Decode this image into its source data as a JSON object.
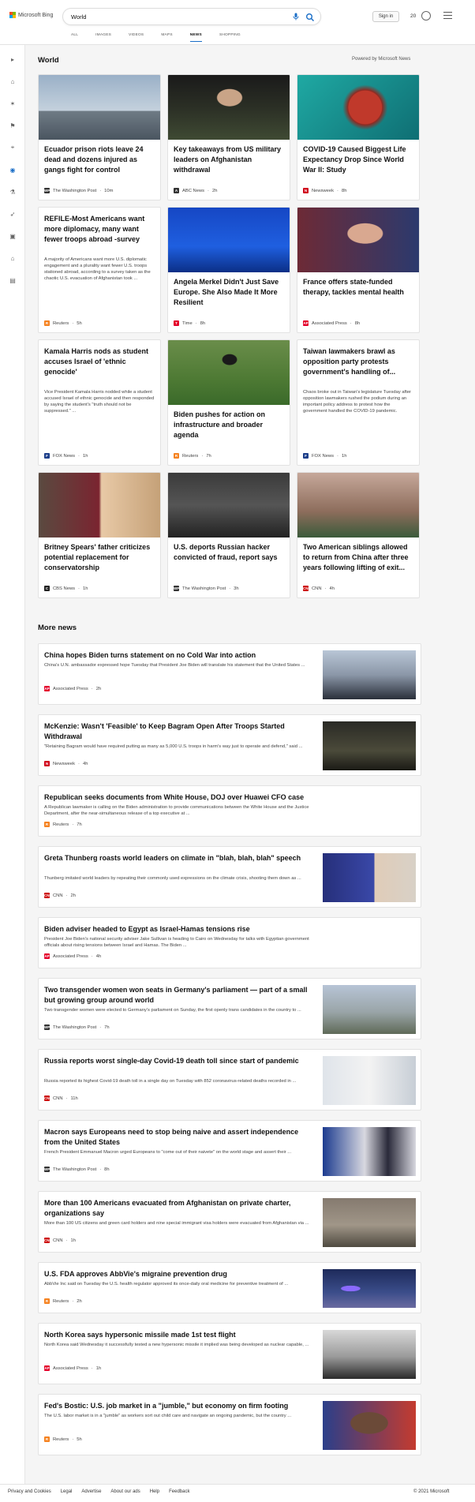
{
  "header": {
    "brand": "Microsoft Bing",
    "search_value": "World",
    "signin_label": "Sign in",
    "points": "20",
    "tabs": [
      "ALL",
      "IMAGES",
      "VIDEOS",
      "MAPS",
      "NEWS",
      "SHOPPING"
    ],
    "active_tab": "NEWS"
  },
  "section": {
    "title": "World",
    "powered_by": "Powered by Microsoft News"
  },
  "cards": [
    {
      "title": "Ecuador prison riots leave 24 dead and dozens injured as gangs fight for control",
      "source": "The Washington Post",
      "time": "10m",
      "logo": "WP",
      "color": "#333"
    },
    {
      "title": "Key takeaways from US military leaders on Afghanistan withdrawal",
      "source": "ABC News",
      "time": "2h",
      "logo": "A",
      "color": "#333"
    },
    {
      "title": "COVID-19 Caused Biggest Life Expectancy Drop Since World War II: Study",
      "source": "Newsweek",
      "time": "8h",
      "logo": "N",
      "color": "#d0021b"
    },
    {
      "title": "REFILE-Most Americans want more diplomacy, many want fewer troops abroad -survey",
      "desc": "A majority of Americans want more U.S. diplomatic engagement and a plurality want fewer U.S. troops stationed abroad, according to a survey taken as the chaotic U.S. evacuation of Afghanistan took ...",
      "source": "Reuters",
      "time": "5h",
      "logo": "R",
      "color": "#f58220"
    },
    {
      "title": "Angela Merkel Didn't Just Save Europe. She Also Made It More Resilient",
      "source": "Time",
      "time": "8h",
      "logo": "T",
      "color": "#e4002b"
    },
    {
      "title": "France offers state-funded therapy, tackles mental health",
      "source": "Associated Press",
      "time": "8h",
      "logo": "AP",
      "color": "#e4002b"
    },
    {
      "title": "Kamala Harris nods as student accuses Israel of 'ethnic genocide'",
      "desc": "Vice President Kamala Harris nodded while a student accused Israel of ethnic genocide and then responded by saying the student's \"truth should not be suppressed.\" ...",
      "source": "FOX News",
      "time": "1h",
      "logo": "F",
      "color": "#1d3f8a"
    },
    {
      "title": "Biden pushes for action on infrastructure and broader agenda",
      "source": "Reuters",
      "time": "7h",
      "logo": "R",
      "color": "#f58220"
    },
    {
      "title": "Taiwan lawmakers brawl as opposition party protests government's handling of...",
      "desc": "Chaos broke out in Taiwan's legislature Tuesday after opposition lawmakers rushed the podium during an important policy address to protest how the government handled the COVID-19 pandemic.",
      "source": "FOX News",
      "time": "1h",
      "logo": "F",
      "color": "#1d3f8a"
    },
    {
      "title": "Britney Spears' father criticizes potential replacement for conservatorship",
      "source": "CBS News",
      "time": "1h",
      "logo": "C",
      "color": "#222"
    },
    {
      "title": "U.S. deports Russian hacker convicted of fraud, report says",
      "source": "The Washington Post",
      "time": "3h",
      "logo": "WP",
      "color": "#333"
    },
    {
      "title": "Two American siblings allowed to return from China after three years following lifting of exit...",
      "source": "CNN",
      "time": "4h",
      "logo": "CNN",
      "color": "#cc0000"
    }
  ],
  "more_news": {
    "title": "More news",
    "items": [
      {
        "title": "China hopes Biden turns statement on no Cold War into action",
        "desc": "China's U.N. ambassador expressed hope Tuesday that President Joe Biden will translate his statement that the United States ...",
        "source": "Associated Press",
        "time": "2h",
        "logo": "AP",
        "color": "#e4002b"
      },
      {
        "title": "McKenzie: Wasn't 'Feasible' to Keep Bagram Open After Troops Started Withdrawal",
        "desc": "\"Retaining Bagram would have required putting as many as 5,000 U.S. troops in harm's way just to operate and defend,\" said ...",
        "source": "Newsweek",
        "time": "4h",
        "logo": "N",
        "color": "#d0021b"
      },
      {
        "title": "Republican seeks documents from White House, DOJ over Huawei CFO case",
        "desc": "A Republican lawmaker is calling on the Biden administration to provide communications between the White House and the Justice Department, after the near-simultaneous release of a top executive at ...",
        "source": "Reuters",
        "time": "7h",
        "logo": "R",
        "color": "#f58220"
      },
      {
        "title": "Greta Thunberg roasts world leaders on climate in \"blah, blah, blah\" speech",
        "desc": "Thunberg imitated world leaders by repeating their commonly used expressions on the climate crisis, shooting them down as ...",
        "source": "CNN",
        "time": "2h",
        "logo": "CNN",
        "color": "#cc0000"
      },
      {
        "title": "Biden adviser headed to Egypt as Israel-Hamas tensions rise",
        "desc": "President Joe Biden's national security adviser Jake Sullivan is heading to Cairo on Wednesday for talks with Egyptian government officials about rising tensions between Israel and Hamas. The Biden ...",
        "source": "Associated Press",
        "time": "4h",
        "logo": "AP",
        "color": "#e4002b"
      },
      {
        "title": "Two transgender women won seats in Germany's parliament — part of a small but growing group around world",
        "desc": "Two transgender women were elected to Germany's parliament on Sunday, the first openly trans candidates in the country to ...",
        "source": "The Washington Post",
        "time": "7h",
        "logo": "WP",
        "color": "#333"
      },
      {
        "title": "Russia reports worst single-day Covid-19 death toll since start of pandemic",
        "desc": "Russia reported its highest Covid-19 death toll in a single day on Tuesday with 852 coronavirus-related deaths recorded in ...",
        "source": "CNN",
        "time": "11h",
        "logo": "CNN",
        "color": "#cc0000"
      },
      {
        "title": "Macron says Europeans need to stop being naive and assert independence from the United States",
        "desc": "French President Emmanuel Macron urged Europeans to \"come out of their naivete\" on the world stage and assert their ...",
        "source": "The Washington Post",
        "time": "8h",
        "logo": "WP",
        "color": "#333"
      },
      {
        "title": "More than 100 Americans evacuated from Afghanistan on private charter, organizations say",
        "desc": "More than 100 US citizens and green card holders and nine special immigrant visa holders were evacuated from Afghanistan via ...",
        "source": "CNN",
        "time": "1h",
        "logo": "CNN",
        "color": "#cc0000"
      },
      {
        "title": "U.S. FDA approves AbbVie's migraine prevention drug",
        "desc": "AbbVie Inc said on Tuesday the U.S. health regulator approved its once-daily oral medicine for preventive treatment of ...",
        "source": "Reuters",
        "time": "2h",
        "logo": "R",
        "color": "#f58220"
      },
      {
        "title": "North Korea says hypersonic missile made 1st test flight",
        "desc": "North Korea said Wednesday it successfully tested a new hypersonic missile it implied was being developed as nuclear capable, ...",
        "source": "Associated Press",
        "time": "1h",
        "logo": "AP",
        "color": "#e4002b"
      },
      {
        "title": "Fed's Bostic: U.S. job market in a \"jumble,\" but economy on firm footing",
        "desc": "The U.S. labor market is in a \"jumble\" as workers sort out child care and navigate an ongoing pandemic, but the country ...",
        "source": "Reuters",
        "time": "5h",
        "logo": "R",
        "color": "#f58220"
      }
    ]
  },
  "footer": {
    "links": [
      "Privacy and Cookies",
      "Legal",
      "Advertise",
      "About our ads",
      "Help",
      "Feedback"
    ],
    "copyright": "© 2021 Microsoft"
  }
}
